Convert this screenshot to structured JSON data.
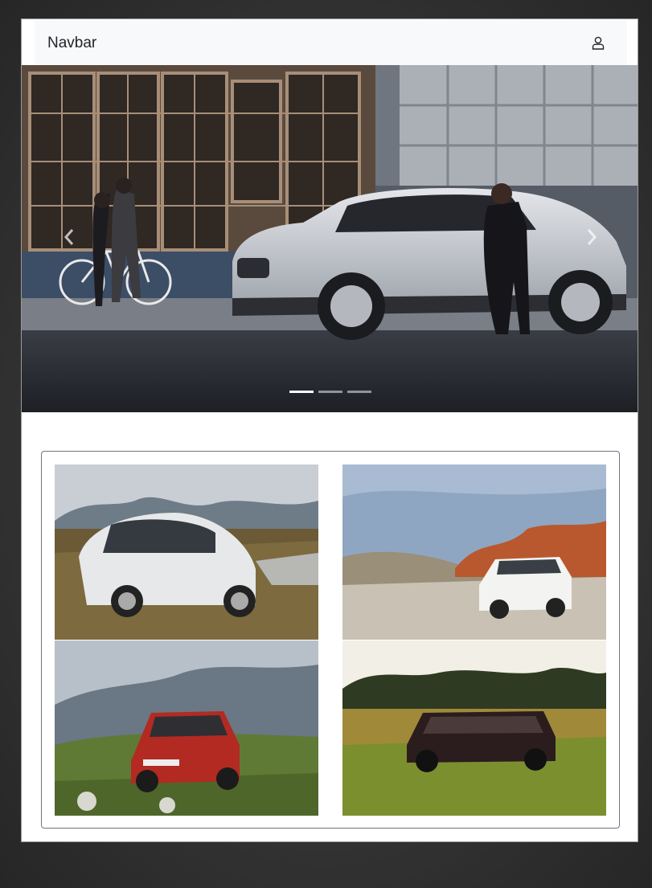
{
  "navbar": {
    "brand": "Navbar",
    "user_icon": "user-icon"
  },
  "carousel": {
    "slide_count": 3,
    "active_index": 0,
    "prev_icon": "chevron-left-icon",
    "next_icon": "chevron-right-icon"
  },
  "gallery": {
    "items": [
      {
        "name": "white-wagon-mountain-photo"
      },
      {
        "name": "white-suv-desert-photo"
      },
      {
        "name": "red-suv-highlands-photo"
      },
      {
        "name": "dark-suv-meadow-photo"
      }
    ]
  },
  "colors": {
    "page_background": "#333333",
    "navbar_background": "#f8f9fa",
    "gallery_border": "#6c757d"
  }
}
